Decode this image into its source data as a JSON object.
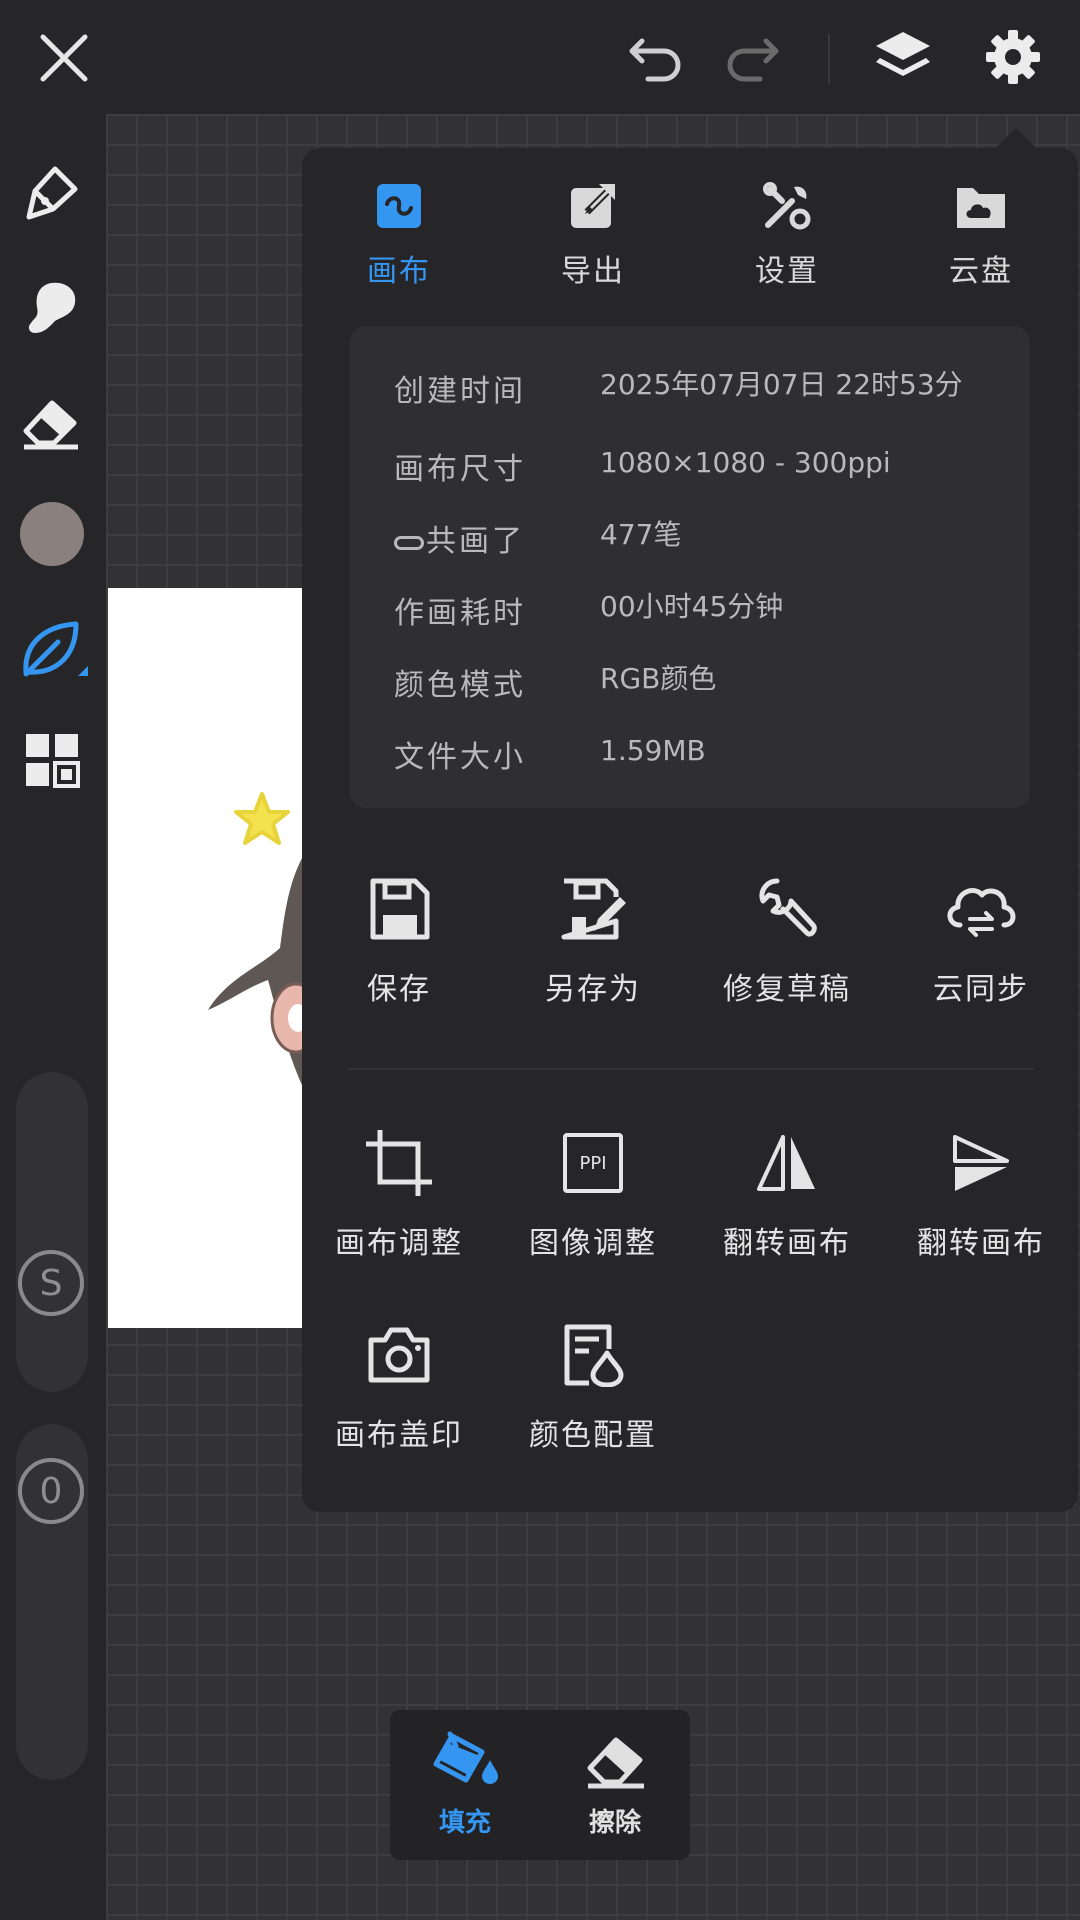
{
  "colors": {
    "accent": "#3596f2",
    "current_brush_color": "#8a807d",
    "panel_bg": "#262628"
  },
  "top_toolbar": {
    "close_icon": "close-icon",
    "undo_icon": "undo-icon",
    "redo_icon": "redo-icon",
    "layers_icon": "layers-icon",
    "settings_icon": "gear-icon"
  },
  "left_tools": [
    "pen-icon",
    "smudge-icon",
    "eraser-icon",
    "color-swatch",
    "leaf-brush-icon",
    "grid-layout-icon"
  ],
  "sliders": {
    "size_knob": "S",
    "opacity_knob": "0"
  },
  "panel": {
    "tabs": [
      {
        "label": "画布",
        "icon": "canvas-icon",
        "active": true
      },
      {
        "label": "导出",
        "icon": "export-icon",
        "active": false
      },
      {
        "label": "设置",
        "icon": "tools-icon",
        "active": false
      },
      {
        "label": "云盘",
        "icon": "cloud-folder-icon",
        "active": false
      }
    ],
    "info": [
      {
        "key": "创建时间",
        "value": "2025年07月07日 22时53分"
      },
      {
        "key": "画布尺寸",
        "value": "1080×1080 - 300ppi"
      },
      {
        "key": "共画了",
        "value": "477笔"
      },
      {
        "key": "作画耗时",
        "value": "00小时45分钟"
      },
      {
        "key": "颜色模式",
        "value": "RGB颜色"
      },
      {
        "key": "文件大小",
        "value": "1.59MB"
      }
    ],
    "actions_row1": [
      {
        "label": "保存",
        "icon": "save-icon"
      },
      {
        "label": "另存为",
        "icon": "save-as-icon"
      },
      {
        "label": "修复草稿",
        "icon": "wrench-icon"
      },
      {
        "label": "云同步",
        "icon": "cloud-sync-icon"
      }
    ],
    "actions_row2": [
      {
        "label": "画布调整",
        "icon": "crop-icon"
      },
      {
        "label": "图像调整",
        "icon": "ppi-icon",
        "icon_text": "PPI"
      },
      {
        "label": "翻转画布",
        "icon": "flip-horizontal-icon"
      },
      {
        "label": "翻转画布",
        "icon": "flip-vertical-icon"
      }
    ],
    "actions_row3": [
      {
        "label": "画布盖印",
        "icon": "camera-icon"
      },
      {
        "label": "颜色配置",
        "icon": "color-config-icon"
      }
    ]
  },
  "mini_toolbar": [
    {
      "label": "填充",
      "icon": "fill-bucket-icon",
      "active": true
    },
    {
      "label": "擦除",
      "icon": "eraser-icon",
      "active": false
    }
  ]
}
